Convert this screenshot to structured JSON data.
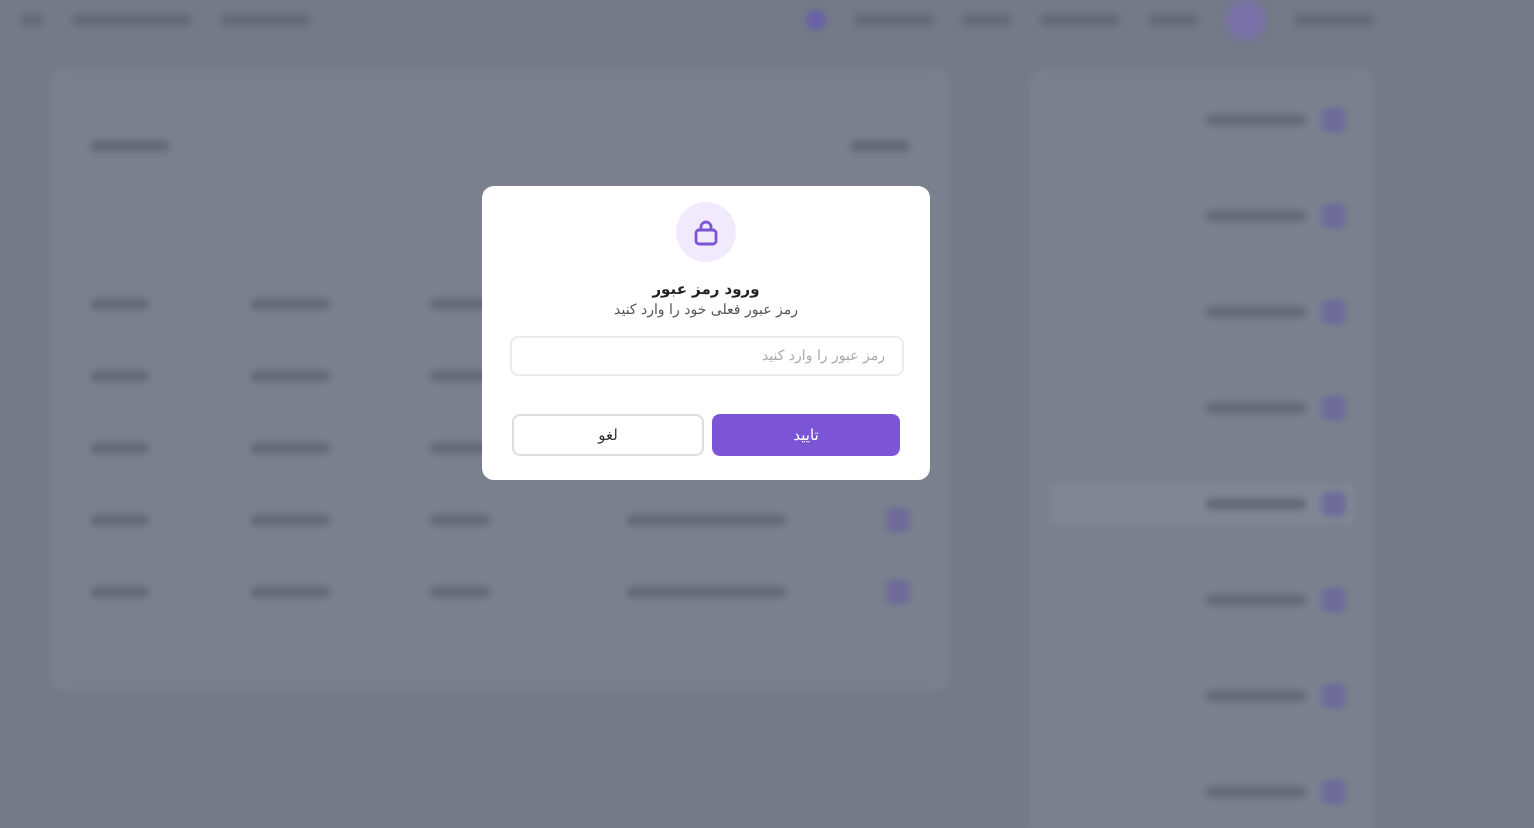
{
  "dialog": {
    "title": "ورود رمز عبور",
    "subtitle": "رمز عبور فعلی خود را وارد کنید",
    "password_field": {
      "placeholder": "رمز عبور را وارد کنید"
    },
    "buttons": [
      {
        "label": "تایید",
        "kind": "primary"
      },
      {
        "label": "لغو",
        "kind": "secondary"
      }
    ]
  }
}
